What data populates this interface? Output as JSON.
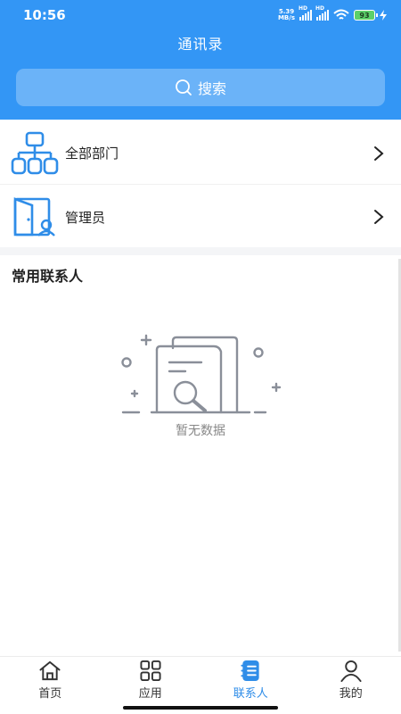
{
  "status_bar": {
    "time": "10:56",
    "net_speed_value": "5.39",
    "net_speed_unit": "MB/s",
    "signal_label": "HD",
    "battery": "93"
  },
  "header": {
    "title": "通讯录",
    "search_label": "搜索"
  },
  "list": {
    "items": [
      {
        "label": "全部部门",
        "icon": "org-chart-icon"
      },
      {
        "label": "管理员",
        "icon": "admin-door-icon"
      }
    ]
  },
  "frequent_contacts": {
    "title": "常用联系人",
    "empty_text": "暂无数据"
  },
  "tabbar": {
    "tabs": [
      {
        "label": "首页",
        "icon": "home-icon",
        "active": false
      },
      {
        "label": "应用",
        "icon": "apps-grid-icon",
        "active": false
      },
      {
        "label": "联系人",
        "icon": "contacts-icon",
        "active": true
      },
      {
        "label": "我的",
        "icon": "user-icon",
        "active": false
      }
    ]
  },
  "colors": {
    "primary": "#3396f5",
    "icon_blue": "#2f8de8",
    "illustration_gray": "#8a8f99"
  }
}
